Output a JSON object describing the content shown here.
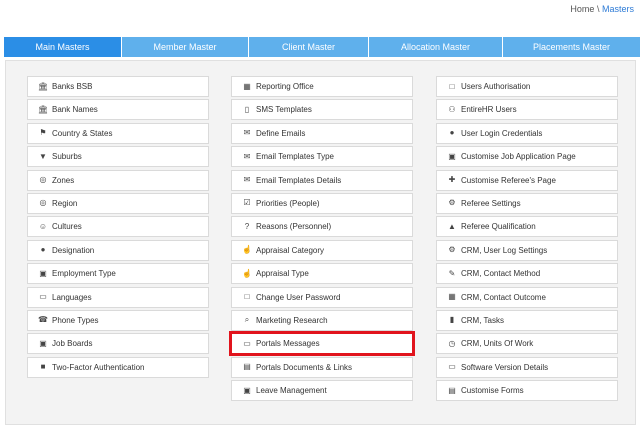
{
  "breadcrumb": {
    "home": "Home",
    "separator": "\\",
    "current": "Masters"
  },
  "tabs": [
    {
      "label": "Main Masters",
      "active": true
    },
    {
      "label": "Member Master",
      "active": false
    },
    {
      "label": "Client Master",
      "active": false
    },
    {
      "label": "Allocation Master",
      "active": false
    },
    {
      "label": "Placements Master",
      "active": false
    }
  ],
  "columns": [
    [
      {
        "label": "Banks BSB",
        "icon": "bank-icon"
      },
      {
        "label": "Bank Names",
        "icon": "bank-icon"
      },
      {
        "label": "Country & States",
        "icon": "flag-icon"
      },
      {
        "label": "Suburbs",
        "icon": "map-marker-icon"
      },
      {
        "label": "Zones",
        "icon": "globe-icon"
      },
      {
        "label": "Region",
        "icon": "globe-icon"
      },
      {
        "label": "Cultures",
        "icon": "smile-icon"
      },
      {
        "label": "Designation",
        "icon": "user-icon"
      },
      {
        "label": "Employment Type",
        "icon": "briefcase-icon"
      },
      {
        "label": "Languages",
        "icon": "language-icon"
      },
      {
        "label": "Phone Types",
        "icon": "phone-icon"
      },
      {
        "label": "Job Boards",
        "icon": "briefcase-icon"
      },
      {
        "label": "Two-Factor Authentication",
        "icon": "lock-icon"
      }
    ],
    [
      {
        "label": "Reporting Office",
        "icon": "building-icon"
      },
      {
        "label": "SMS Templates",
        "icon": "mobile-icon"
      },
      {
        "label": "Define Emails",
        "icon": "envelope-icon"
      },
      {
        "label": "Email Templates Type",
        "icon": "envelope-icon"
      },
      {
        "label": "Email Templates Details",
        "icon": "envelope-icon"
      },
      {
        "label": "Priorities (People)",
        "icon": "checkbox-icon"
      },
      {
        "label": "Reasons (Personnel)",
        "icon": "question-icon"
      },
      {
        "label": "Appraisal Category",
        "icon": "thumbs-up-icon"
      },
      {
        "label": "Appraisal Type",
        "icon": "thumbs-up-icon"
      },
      {
        "label": "Change User Password",
        "icon": "unlock-icon"
      },
      {
        "label": "Marketing Research",
        "icon": "search-icon"
      },
      {
        "label": "Portals Messages",
        "icon": "monitor-icon",
        "highlight": true
      },
      {
        "label": "Portals Documents & Links",
        "icon": "document-icon"
      },
      {
        "label": "Leave Management",
        "icon": "briefcase-icon"
      }
    ],
    [
      {
        "label": "Users Authorisation",
        "icon": "unlock-icon"
      },
      {
        "label": "EntireHR Users",
        "icon": "users-icon"
      },
      {
        "label": "User Login Credentials",
        "icon": "user-icon"
      },
      {
        "label": "Customise Job Application Page",
        "icon": "briefcase-icon"
      },
      {
        "label": "Customise Referee's Page",
        "icon": "user-plus-icon"
      },
      {
        "label": "Referee Settings",
        "icon": "gears-icon"
      },
      {
        "label": "Referee Qualification",
        "icon": "graduation-cap-icon"
      },
      {
        "label": "CRM, User Log Settings",
        "icon": "gear-icon"
      },
      {
        "label": "CRM, Contact Method",
        "icon": "pen-icon"
      },
      {
        "label": "CRM, Contact Outcome",
        "icon": "calendar-icon"
      },
      {
        "label": "CRM, Tasks",
        "icon": "file-icon"
      },
      {
        "label": "CRM, Units Of Work",
        "icon": "clock-icon"
      },
      {
        "label": "Software Version Details",
        "icon": "monitor-icon"
      },
      {
        "label": "Customise Forms",
        "icon": "document-icon"
      }
    ]
  ]
}
